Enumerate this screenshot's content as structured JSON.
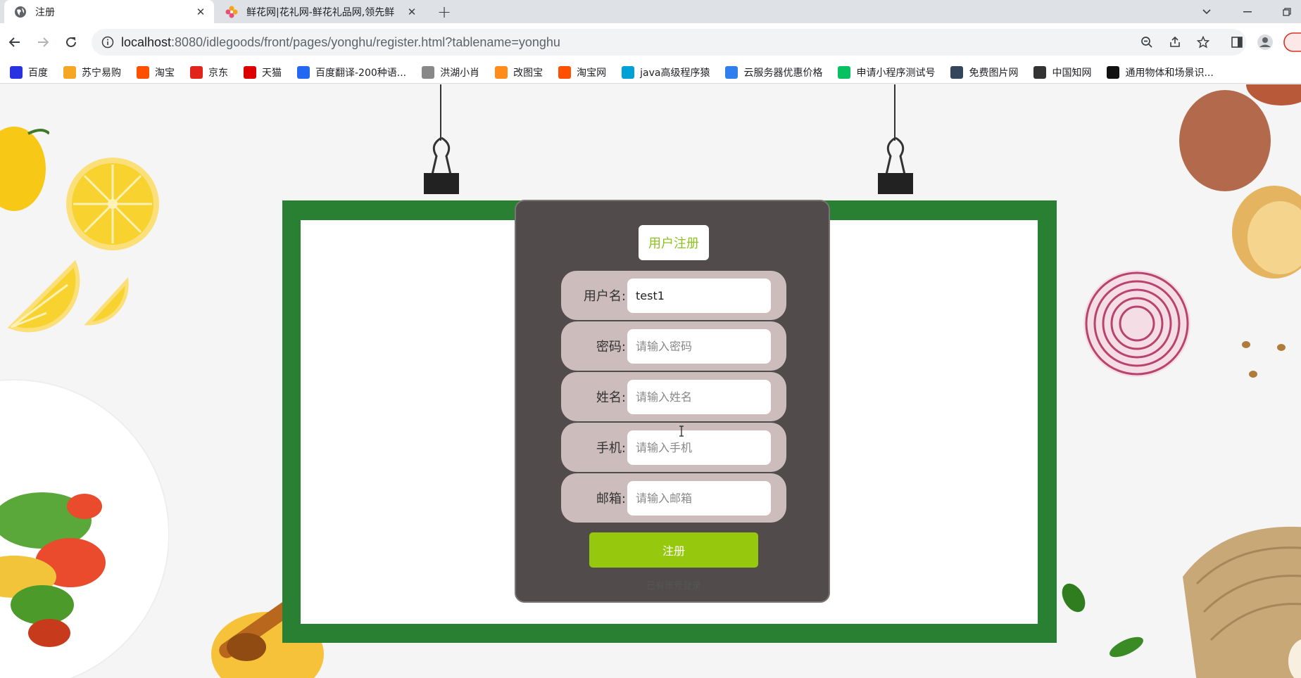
{
  "browser": {
    "tabs": [
      {
        "title": "注册",
        "close": "✕"
      },
      {
        "title": "鲜花网|花礼网-鲜花礼品网,领先鲜",
        "close": "✕"
      }
    ],
    "new_tab": "+",
    "url_host": "localhost",
    "url_rest": ":8080/idlegoods/front/pages/yonghu/register.html?tablename=yonghu",
    "bookmarks": [
      {
        "label": "百度",
        "icon": "baidu-icon",
        "color": "#2932e1"
      },
      {
        "label": "苏宁易购",
        "icon": "suning-icon",
        "color": "#f5a623"
      },
      {
        "label": "淘宝",
        "icon": "taobao-icon",
        "color": "#ff5000"
      },
      {
        "label": "京东",
        "icon": "jd-icon",
        "color": "#e1251b"
      },
      {
        "label": "天猫",
        "icon": "tmall-icon",
        "color": "#d00"
      },
      {
        "label": "百度翻译-200种语...",
        "icon": "translate-icon",
        "color": "#2468f2"
      },
      {
        "label": "洪湖小肖",
        "icon": "bird-icon",
        "color": "#888"
      },
      {
        "label": "改图宝",
        "icon": "gaitubao-icon",
        "color": "#ff8c1a"
      },
      {
        "label": "淘宝网",
        "icon": "taobao-icon",
        "color": "#ff5000"
      },
      {
        "label": "java高级程序猿",
        "icon": "bilibili-icon",
        "color": "#00a1d6"
      },
      {
        "label": "云服务器优惠价格",
        "icon": "cloud-icon",
        "color": "#2f80ed"
      },
      {
        "label": "申请小程序测试号",
        "icon": "wechat-icon",
        "color": "#07c160"
      },
      {
        "label": "免费图片网",
        "icon": "t-icon",
        "color": "#35465c"
      },
      {
        "label": "中国知网",
        "icon": "cnki-icon",
        "color": "#333"
      },
      {
        "label": "通用物体和场景识...",
        "icon": "ai-icon",
        "color": "#111"
      }
    ]
  },
  "form": {
    "title": "用户注册",
    "fields": [
      {
        "label": "用户名:",
        "value": "test1",
        "placeholder": ""
      },
      {
        "label": "密码:",
        "value": "",
        "placeholder": "请输入密码"
      },
      {
        "label": "姓名:",
        "value": "",
        "placeholder": "请输入姓名"
      },
      {
        "label": "手机:",
        "value": "",
        "placeholder": "请输入手机"
      },
      {
        "label": "邮箱:",
        "value": "",
        "placeholder": "请输入邮箱"
      }
    ],
    "submit_label": "注册",
    "login_link": "已有账号登录"
  },
  "colors": {
    "frame": "#2a8032",
    "card": "#514b4b",
    "row": "#cdbcbc",
    "accent": "#96c80e"
  }
}
